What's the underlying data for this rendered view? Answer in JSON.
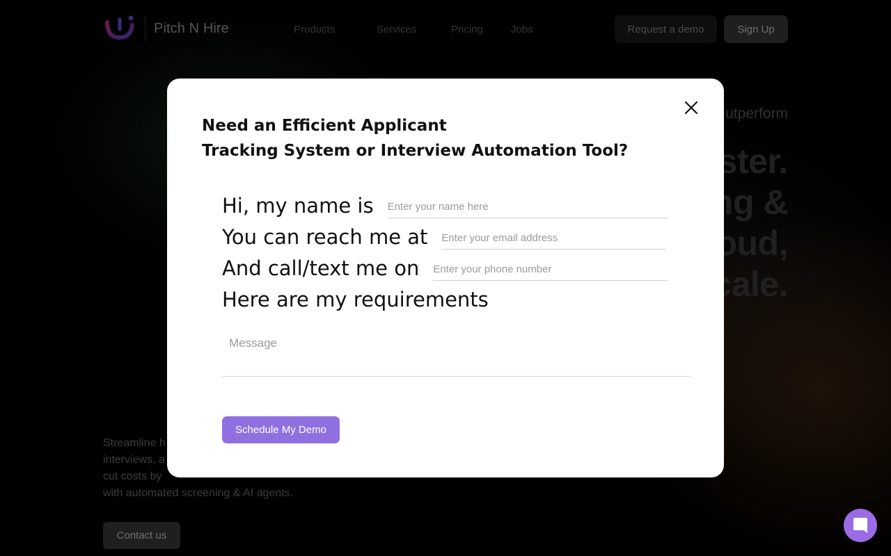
{
  "header": {
    "brand": "Pitch N Hire",
    "nav": [
      "Products",
      "Services",
      "Pricing",
      "Jobs"
    ],
    "request_demo": "Request a demo",
    "sign_up": "Sign Up"
  },
  "hero": {
    "tagline_fragment": "utperform",
    "headline_fragments": [
      "ster.",
      "ng &",
      "oud,",
      "cale."
    ],
    "description": "Streamline h interviews, a cut costs by , and reduce HR workload by 70% with automated screening & AI agents.",
    "description_lines": [
      "Streamline h",
      "interviews, a",
      "cut costs by",
      "with automated screening & AI agents."
    ],
    "contact_button": "Contact us"
  },
  "modal": {
    "title_line1": "Need an Efficient Applicant",
    "title_line2": "Tracking System or Interview Automation Tool?",
    "fields": {
      "name": {
        "label": "Hi, my name is",
        "placeholder": "Enter your name here"
      },
      "email": {
        "label": "You can reach me at",
        "placeholder": "Enter your email address"
      },
      "phone": {
        "label": "And call/text me on",
        "placeholder": "Enter your phone number"
      },
      "requirements": {
        "label": "Here are my requirements"
      },
      "message": {
        "placeholder": "Message"
      }
    },
    "submit": "Schedule My Demo"
  },
  "colors": {
    "accent": "#9070e0",
    "chat_launcher": "#9b6be6",
    "modal_bg": "#ffffff"
  },
  "icons": {
    "close": "close-icon",
    "chat": "chat-icon",
    "logo": "logo-icon"
  }
}
